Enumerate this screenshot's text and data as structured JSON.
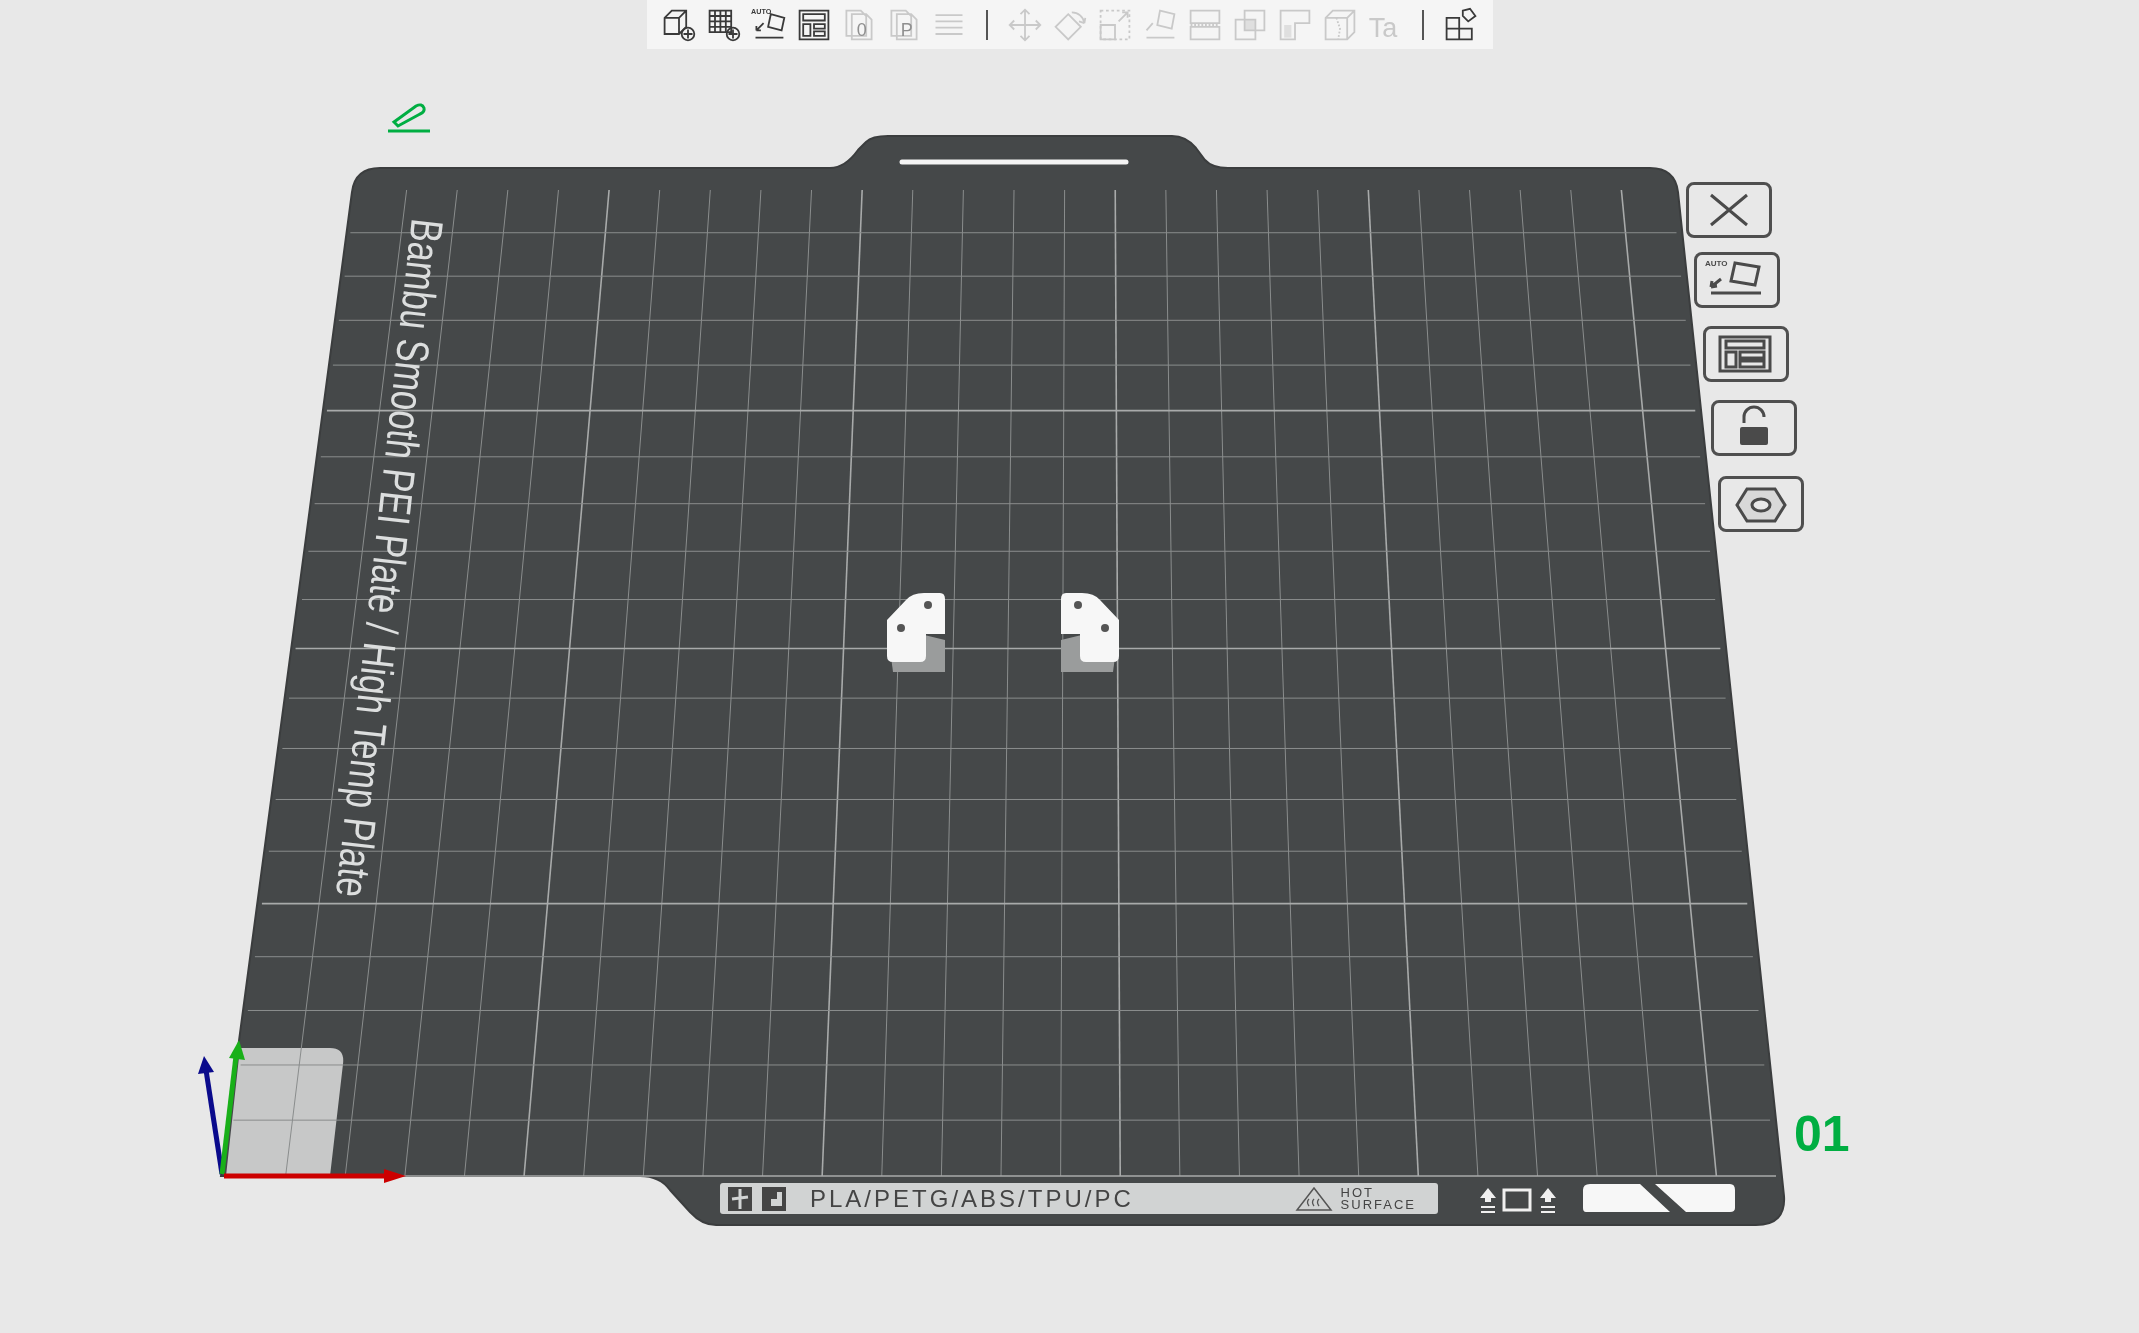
{
  "toolbar": [
    {
      "kind": "add-object",
      "disabled": false
    },
    {
      "kind": "add-plate",
      "disabled": false
    },
    {
      "kind": "auto-orient",
      "glyph": "AUTO",
      "disabled": false
    },
    {
      "kind": "arrange",
      "disabled": false
    },
    {
      "kind": "copy",
      "glyph": "0",
      "disabled": true
    },
    {
      "kind": "copy",
      "glyph": "P",
      "disabled": true
    },
    {
      "kind": "layers",
      "disabled": true
    },
    {
      "kind": "separator"
    },
    {
      "kind": "move",
      "disabled": true
    },
    {
      "kind": "rotate",
      "disabled": true
    },
    {
      "kind": "scale",
      "disabled": true
    },
    {
      "kind": "lay-on-face",
      "disabled": true
    },
    {
      "kind": "cut",
      "disabled": true
    },
    {
      "kind": "boolean",
      "disabled": true
    },
    {
      "kind": "support",
      "disabled": true
    },
    {
      "kind": "seam",
      "disabled": true
    },
    {
      "kind": "text",
      "glyph": "Ta",
      "disabled": true
    },
    {
      "kind": "separator"
    },
    {
      "kind": "assembly",
      "disabled": false
    }
  ],
  "plate": {
    "name": "Bambu Smooth PEI Plate / High Temp Plate",
    "number": "01",
    "filaments": "PLA/PETG/ABS/TPU/PC",
    "warning": [
      "HOT",
      "SURFACE"
    ]
  },
  "plate_buttons": [
    {
      "kind": "delete"
    },
    {
      "kind": "auto-orient",
      "glyph": "AUTO"
    },
    {
      "kind": "arrange"
    },
    {
      "kind": "lock",
      "locked": false
    },
    {
      "kind": "settings"
    }
  ],
  "objects": [
    {
      "kind": "bracket",
      "mirrored": false
    },
    {
      "kind": "bracket",
      "mirrored": true
    }
  ]
}
